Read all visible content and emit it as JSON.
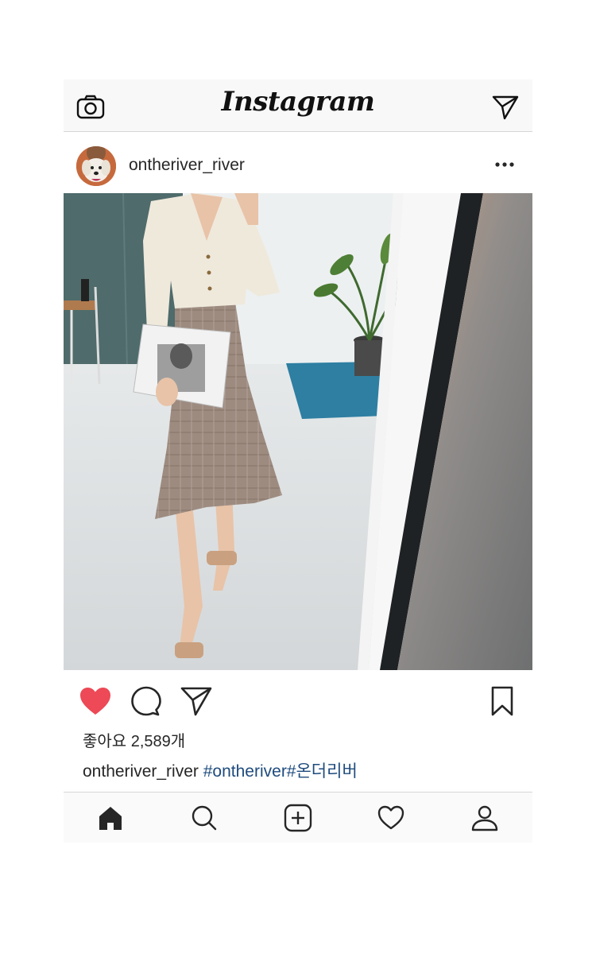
{
  "app": {
    "name": "Instagram"
  },
  "post": {
    "username": "ontheriver_river",
    "likes_text": "좋아요 2,589개",
    "caption_user": "ontheriver_river",
    "caption_tags": "#ontheriver#온더리버",
    "liked": true
  },
  "icons": {
    "top_left": "camera-icon",
    "top_right": "direct-message-icon",
    "more": "more-options-icon",
    "like": "heart-filled-icon",
    "comment": "comment-icon",
    "share": "send-icon",
    "save": "bookmark-icon",
    "nav": [
      "home-icon",
      "search-icon",
      "add-post-icon",
      "activity-heart-icon",
      "profile-icon"
    ]
  },
  "colors": {
    "like_red": "#ed4956",
    "hashtag_blue": "#1e4b7d",
    "text": "#262626",
    "bar_bg": "#f8f8f8"
  }
}
